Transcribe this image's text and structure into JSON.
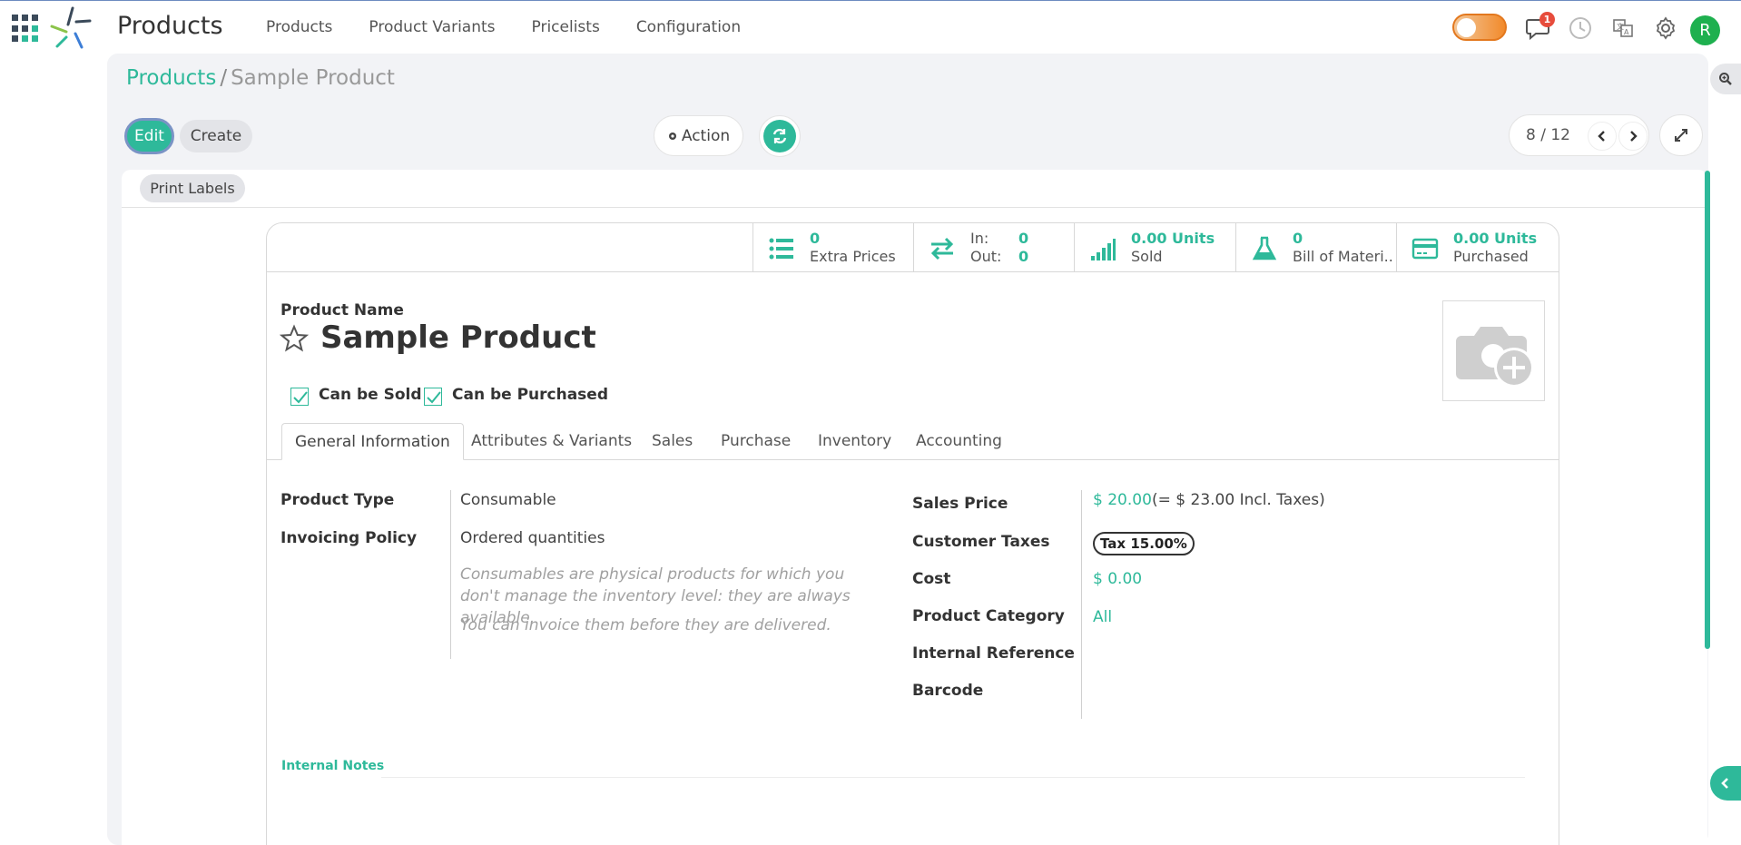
{
  "app": {
    "title": "Products",
    "menu": [
      "Products",
      "Product Variants",
      "Pricelists",
      "Configuration"
    ],
    "notification_count": "1",
    "avatar_initial": "R"
  },
  "breadcrumb": {
    "parent": "Products",
    "separator": "/",
    "current": "Sample Product"
  },
  "toolbar": {
    "edit_label": "Edit",
    "create_label": "Create",
    "action_label": "Action",
    "pager_value": "8 / 12"
  },
  "statusbar": {
    "print_labels": "Print Labels"
  },
  "stat_buttons": {
    "extra_prices": {
      "value": "0",
      "label": "Extra Prices"
    },
    "in_out": {
      "in_label": "In:",
      "in_value": "0",
      "out_label": "Out:",
      "out_value": "0"
    },
    "sold": {
      "value": "0.00 Units",
      "label": "Sold"
    },
    "bom": {
      "value": "0",
      "label": "Bill of Materi..."
    },
    "purchased": {
      "value": "0.00 Units",
      "label": "Purchased"
    }
  },
  "product": {
    "name_label": "Product Name",
    "name": "Sample Product",
    "can_be_sold_label": "Can be Sold",
    "can_be_purchased_label": "Can be Purchased"
  },
  "tabs": [
    "General Information",
    "Attributes & Variants",
    "Sales",
    "Purchase",
    "Inventory",
    "Accounting"
  ],
  "general_info": {
    "product_type_label": "Product Type",
    "product_type": "Consumable",
    "invoicing_policy_label": "Invoicing Policy",
    "invoicing_policy": "Ordered quantities",
    "help_1": "Consumables are physical products for which you don't manage the inventory level: they are always available.",
    "help_2": "You can invoice them before they are delivered.",
    "sales_price_label": "Sales Price",
    "sales_price": "$ 20.00",
    "sales_price_incl": "(= $ 23.00 Incl. Taxes)",
    "customer_taxes_label": "Customer Taxes",
    "customer_tax": "Tax 15.00%",
    "cost_label": "Cost",
    "cost": "$ 0.00",
    "category_label": "Product Category",
    "category": "All",
    "internal_ref_label": "Internal Reference",
    "barcode_label": "Barcode"
  },
  "notes": {
    "label": "Internal Notes"
  },
  "colors": {
    "accent": "#2eb99a",
    "badge": "#e74c3c",
    "avatar": "#1eb04f"
  }
}
